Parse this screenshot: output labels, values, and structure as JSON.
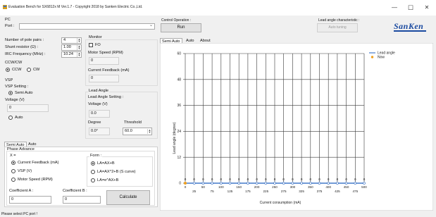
{
  "window": {
    "title": "Evaluation Bench for SX6812x M Ver.1.7 - Copyright 2018 by Sanken Electric Co.,Ltd.",
    "minimize_glyph": "—",
    "maximize_glyph": "☐",
    "close_glyph": "✕"
  },
  "pc": {
    "group_label": "PC",
    "port_label": "Port :",
    "port_value": "",
    "dropdown_glyph": "⌄"
  },
  "control": {
    "label": "Control Operation :",
    "run_label": "Run"
  },
  "lead_char": {
    "label": "Lead angle characteristic :",
    "button_label": "Auto tuning"
  },
  "logo": {
    "text": "SanKen",
    "color": "#1a4aa0"
  },
  "params": {
    "pole_pairs_label": "Number of pole pairs :",
    "pole_pairs_value": "4",
    "shunt_label": "Shunt resistor (Ω) :",
    "shunt_value": "1.00",
    "irc_label": "IRC Frequency (MHz) :",
    "irc_value": "10.24",
    "spin_up": "▲",
    "spin_down": "▼"
  },
  "monitor": {
    "label": "Monitor",
    "fo_label": "FO",
    "speed_label": "Motor Speed (RPM)",
    "speed_value": "0",
    "feedback_label": "Current Feedback (mA)",
    "feedback_value": "0"
  },
  "direction": {
    "label": "CCW/CW",
    "ccw_label": "CCW",
    "cw_label": "CW"
  },
  "vsp": {
    "label": "VSP",
    "setting_label": "VSP Setting :",
    "semi_auto_label": "Semi Auto",
    "voltage_label": "Voltage (V)",
    "voltage_value": "0",
    "auto_label": "Auto"
  },
  "lead_angle": {
    "label": "Lead Angle",
    "setting_label": "Lead Angle Setting :",
    "voltage_label": "Voltage (V)",
    "voltage_value": "0.0",
    "degree_label": "Degree",
    "degree_value": "0.0°",
    "threshold_label": "Threshold",
    "threshold_value": "60.0"
  },
  "lower_tabs": [
    "Semi Auto",
    "Auto"
  ],
  "phase_advance": {
    "label": "Phase Advance",
    "x_label": "X =",
    "x_options": [
      "Current Feedback (mA)",
      "VSP (V)",
      "Motor Speed (RPM)"
    ],
    "form_label": "Form :",
    "form_options": [
      "LA=AX+B",
      "LA=AX^2+B (S curve)",
      "LA=e^AX+B"
    ],
    "coeff_a_label": "Coefficient A :",
    "coeff_a_value": "0",
    "coeff_b_label": "Coefficient B :",
    "coeff_b_value": "0",
    "calculate_label": "Calculate"
  },
  "chart_tabs": [
    "Semi Auto",
    "Auto",
    "About"
  ],
  "chart_data": {
    "type": "line",
    "xlabel": "Current consumption (mA)",
    "ylabel": "Lead angle (degree)",
    "xlim": [
      0,
      500
    ],
    "ylim": [
      0,
      60
    ],
    "x_ticks": [
      0,
      25,
      50,
      75,
      100,
      125,
      150,
      175,
      200,
      225,
      250,
      275,
      300,
      325,
      350,
      375,
      400,
      425,
      450,
      475,
      500
    ],
    "y_ticks": [
      0,
      12,
      24,
      36,
      48,
      60
    ],
    "grid": true,
    "legend_position": "top-right",
    "series": [
      {
        "name": "Lead angle",
        "color": "#1f5fbf",
        "x": [
          0,
          25,
          50,
          75,
          100,
          125,
          150,
          175,
          200,
          225,
          250,
          275,
          300,
          325,
          350,
          375,
          400,
          425,
          450,
          475,
          500
        ],
        "values": [
          0,
          0,
          0,
          0,
          0,
          0,
          0,
          0,
          0,
          0,
          0,
          0,
          0,
          0,
          0,
          0,
          0,
          0,
          0,
          0,
          0
        ]
      },
      {
        "name": "Now",
        "color": "#f0a020",
        "x": [
          0
        ],
        "values": [
          0
        ]
      }
    ]
  },
  "status_text": "Please select PC port !"
}
